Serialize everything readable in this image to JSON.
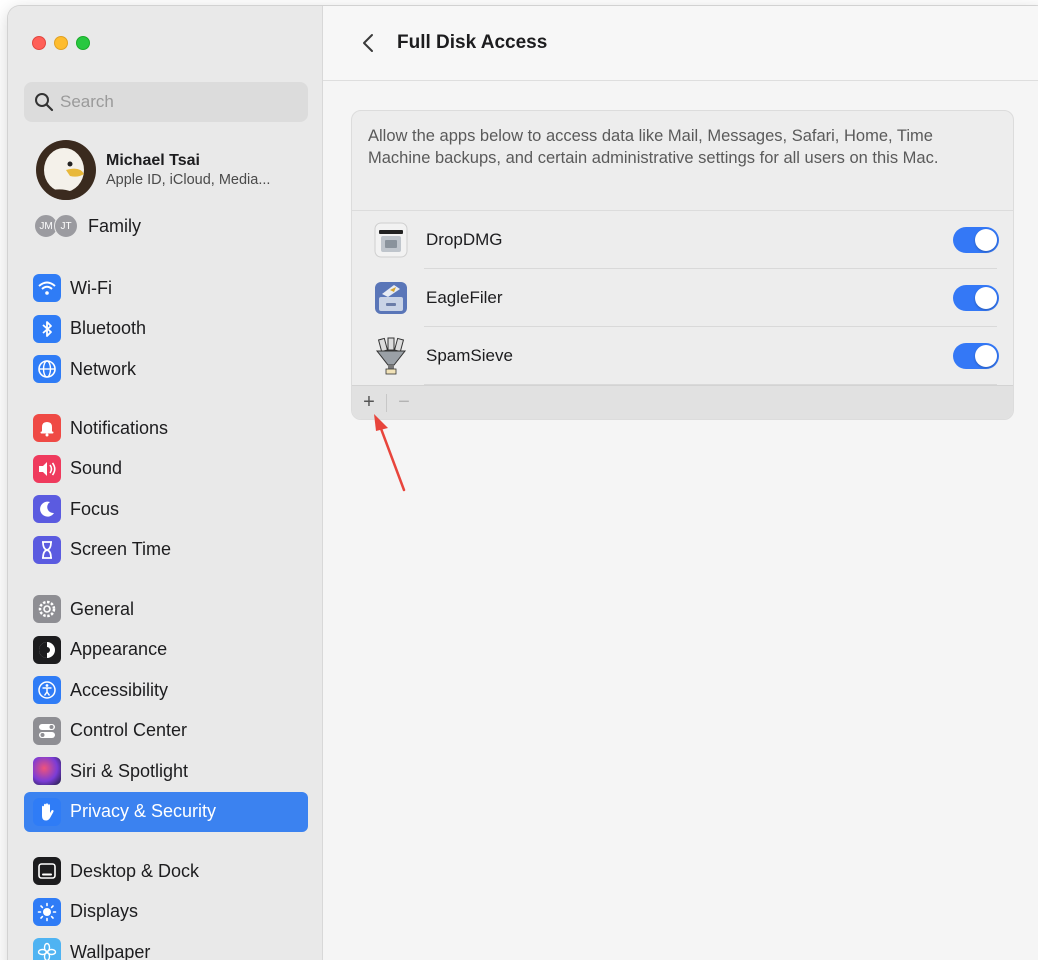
{
  "window": {
    "search": {
      "placeholder": "Search"
    },
    "profile": {
      "name": "Michael Tsai",
      "subtitle": "Apple ID, iCloud, Media..."
    },
    "family": {
      "badges": [
        "JM",
        "JT"
      ],
      "label": "Family"
    },
    "sidebar": {
      "group1": [
        {
          "label": "Wi-Fi",
          "icon": "wifi-icon"
        },
        {
          "label": "Bluetooth",
          "icon": "bluetooth-icon"
        },
        {
          "label": "Network",
          "icon": "globe-icon"
        }
      ],
      "group2": [
        {
          "label": "Notifications",
          "icon": "bell-icon"
        },
        {
          "label": "Sound",
          "icon": "speaker-icon"
        },
        {
          "label": "Focus",
          "icon": "moon-icon"
        },
        {
          "label": "Screen Time",
          "icon": "hourglass-icon"
        }
      ],
      "group3": [
        {
          "label": "General",
          "icon": "gear-icon"
        },
        {
          "label": "Appearance",
          "icon": "appearance-icon"
        },
        {
          "label": "Accessibility",
          "icon": "accessibility-icon"
        },
        {
          "label": "Control Center",
          "icon": "toggles-icon"
        },
        {
          "label": "Siri & Spotlight",
          "icon": "siri-icon"
        },
        {
          "label": "Privacy & Security",
          "icon": "hand-icon",
          "selected": true
        }
      ],
      "group4": [
        {
          "label": "Desktop & Dock",
          "icon": "dock-icon"
        },
        {
          "label": "Displays",
          "icon": "sun-icon"
        },
        {
          "label": "Wallpaper",
          "icon": "flower-icon"
        }
      ]
    }
  },
  "main": {
    "title": "Full Disk Access",
    "description": "Allow the apps below to access data like Mail, Messages, Safari, Home, Time Machine backups, and certain administrative settings for all users on this Mac.",
    "apps": [
      {
        "name": "DropDMG",
        "enabled": true
      },
      {
        "name": "EagleFiler",
        "enabled": true
      },
      {
        "name": "SpamSieve",
        "enabled": true
      }
    ],
    "footer": {
      "add": "+",
      "remove": "−"
    }
  },
  "colors": {
    "accent": "#3478f6",
    "selected": "#3b82f0",
    "annotation_arrow": "#e8453c"
  }
}
